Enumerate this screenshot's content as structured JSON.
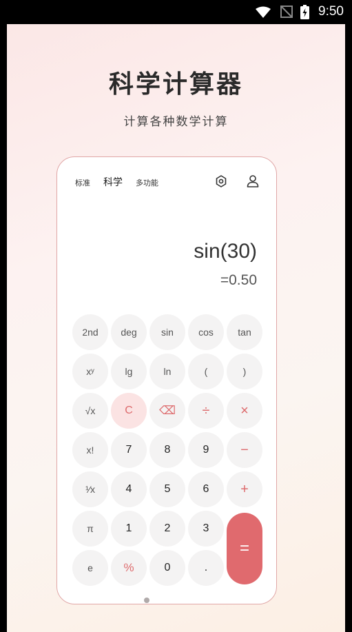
{
  "status_bar": {
    "time": "9:50"
  },
  "promo": {
    "title": "科学计算器",
    "subtitle": "计算各种数学计算"
  },
  "calculator": {
    "tabs": [
      "标准",
      "科学",
      "多功能"
    ],
    "active_tab": "科学",
    "expression": "sin(30)",
    "result": "=0.50",
    "keys": {
      "r1": [
        "2nd",
        "deg",
        "sin",
        "cos",
        "tan"
      ],
      "r2": [
        "xʸ",
        "lg",
        "ln",
        "(",
        ")"
      ],
      "r3": [
        "√x",
        "C",
        "⌫",
        "÷",
        "×"
      ],
      "r4": [
        "x!",
        "7",
        "8",
        "9",
        "−"
      ],
      "r5": [
        "¹⁄x",
        "4",
        "5",
        "6",
        "+"
      ],
      "r6": [
        "π",
        "1",
        "2",
        "3"
      ],
      "r7": [
        "e",
        "%",
        "0",
        "."
      ],
      "equals": "="
    }
  },
  "colors": {
    "accent": "#e06a6e",
    "key_bg": "#f4f3f3"
  }
}
